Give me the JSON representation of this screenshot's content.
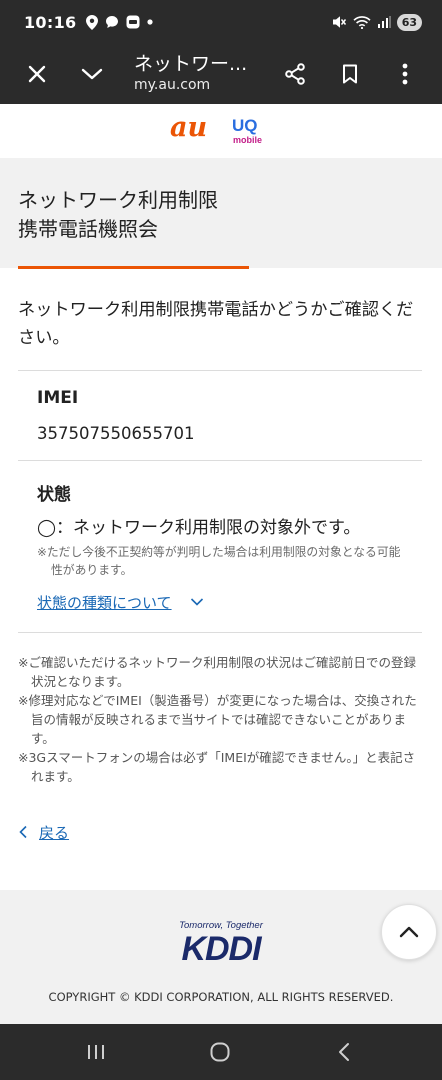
{
  "status_bar": {
    "time": "10:16",
    "battery": "63",
    "left_icons": [
      "location-icon",
      "chat-bubble-icon",
      "app-icon",
      "dot-icon"
    ],
    "right_icons": [
      "mute-icon",
      "wifi-icon",
      "signal-icon"
    ]
  },
  "browser": {
    "title": "ネットワー...",
    "url": "my.au.com"
  },
  "brand": {
    "au": "au",
    "uq": "UQ",
    "uq_sub": "mobile"
  },
  "page": {
    "title_line1": "ネットワーク利用制限",
    "title_line2": "携帯電話機照会",
    "intro": "ネットワーク利用制限携帯電話かどうかご確認ください。",
    "imei_label": "IMEI",
    "imei_value": "357507550655701",
    "status_label": "状態",
    "status_value": "◯：ネットワーク利用制限の対象外です。",
    "status_note": "※ただし今後不正契約等が判明した場合は利用制限の対象となる可能性があります。",
    "status_types_link": "状態の種類について",
    "footnotes": [
      "※ご確認いただけるネットワーク利用制限の状況はご確認前日での登録状況となります。",
      "※修理対応などでIMEI（製造番号）が変更になった場合は、交換された旨の情報が反映されるまで当サイトでは確認できないことがあります。",
      "※3Gスマートフォンの場合は必ず「IMEIが確認できません。」と表記されます。"
    ],
    "back_link": "戻る"
  },
  "footer": {
    "tagline": "Tomorrow, Together",
    "logo": "KDDI",
    "copyright": "COPYRIGHT © KDDI CORPORATION, ALL RIGHTS RESERVED."
  },
  "colors": {
    "accent_orange": "#eb5505",
    "link_blue": "#1a68b5",
    "kddi_navy": "#1b2a6a",
    "system_bar": "#2b2b2b"
  }
}
